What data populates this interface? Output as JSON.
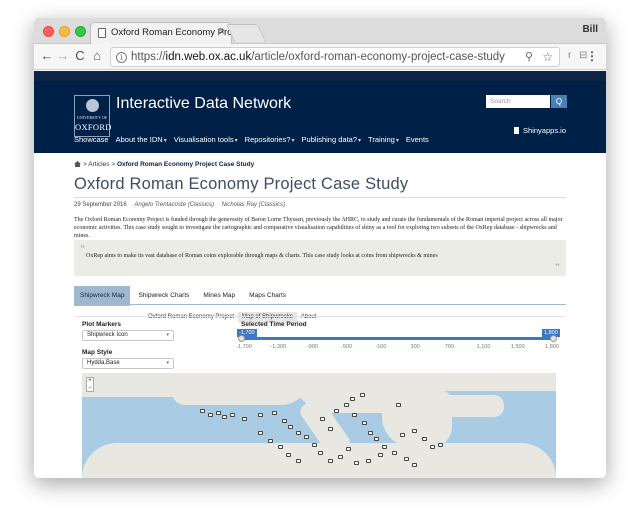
{
  "browser": {
    "tab_title": "Oxford Roman Economy Proje",
    "tab_close": "×",
    "profile_name": "Bill",
    "url_host": "idn.web.ox.ac.uk",
    "url_prefix": "https://",
    "url_path": "/article/oxford-roman-economy-project-case-study",
    "nav_back": "←",
    "nav_forward": "→",
    "nav_reload": "C",
    "nav_home": "⌂",
    "info_icon": "i",
    "zoom_icon": "⚲",
    "star_icon": "☆",
    "ext_labels": [
      "r",
      "⊟",
      "◻"
    ],
    "menu_icon": "⋮"
  },
  "site": {
    "title": "Interactive Data Network",
    "logo_university": "UNIVERSITY OF",
    "logo_name": "OXFORD",
    "search_placeholder": "Search",
    "search_button": "Q",
    "shinyapps_link": "Shinyapps.io",
    "nav": [
      {
        "label": "Showcase",
        "caret": ""
      },
      {
        "label": "About the IDN",
        "caret": "▾"
      },
      {
        "label": "Visualisation tools",
        "caret": "▾"
      },
      {
        "label": "Repositories?",
        "caret": "▾"
      },
      {
        "label": "Publishing data?",
        "caret": "▾"
      },
      {
        "label": "Training",
        "caret": "▾"
      },
      {
        "label": "Events",
        "caret": ""
      }
    ]
  },
  "breadcrumb": {
    "separator": "> Articles >",
    "current": "Oxford Roman Economy Project Case Study"
  },
  "article": {
    "title": "Oxford Roman Economy Project Case Study",
    "date": "29 September 2016",
    "authors": [
      "Angelo Trentacoste (Classics)",
      "Nicholas Ray (Classics)"
    ],
    "body": "The Oxford Roman Economy Project is funded through the generosity of Baron Lorne Thyssen, previously the AHRC, to study and curate the fundamentals of the Roman imperial project across all major economic activities. This case study sought to investigate the cartographic and comparative visualisation capabilities of shiny as a tool for exploring two subsets of the OxRep database - shipwrecks and mines.",
    "quote_open": "❝",
    "quote": "OxRep aims to make its vast database of Roman coins explorable through maps & charts. This case study looks at coins from shipwrecks & mines",
    "quote_close": "❞"
  },
  "app": {
    "tabs": [
      "Shipwreck Map",
      "Shipwreck Charts",
      "Mines Map",
      "Maps Charts"
    ],
    "active_tab": 0,
    "subtabs": [
      "Oxford Roman Economy Project",
      "Map of Shipwrecks",
      "About"
    ],
    "active_subtab": 1,
    "plot_markers_label": "Plot Markers",
    "plot_markers_value": "Shipwreck Icon",
    "map_style_label": "Map Style",
    "map_style_value": "Hydda.Base",
    "dropdown_caret": "▾",
    "time_label": "Selected Time Period",
    "time_range": {
      "min_label": "-1,700",
      "max_label": "1,800"
    },
    "time_ticks": [
      "-1,700",
      "-1,300",
      "-900",
      "-500",
      "-100",
      "300",
      "700",
      "1,100",
      "1,500",
      "1,800"
    ],
    "zoom_in": "+",
    "zoom_out": "−"
  },
  "colors": {
    "header_navy": "#002147",
    "active_tab": "#9fb8ce",
    "slider_blue": "#3c78c4",
    "sea": "#a9cbe3",
    "land": "#e9e7e2"
  }
}
